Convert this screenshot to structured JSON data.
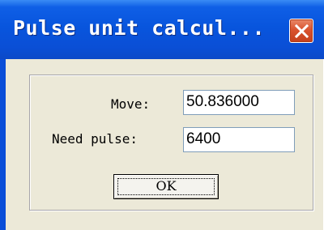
{
  "window": {
    "title": "Pulse unit calcul...",
    "close_icon": "close-x-icon",
    "title_color": "#0a4fd6",
    "close_color": "#d9532f"
  },
  "form": {
    "move_label": "Move:",
    "move_value": "50.836000",
    "pulse_label": "Need pulse:",
    "pulse_value": "6400",
    "ok_label": "OK"
  }
}
